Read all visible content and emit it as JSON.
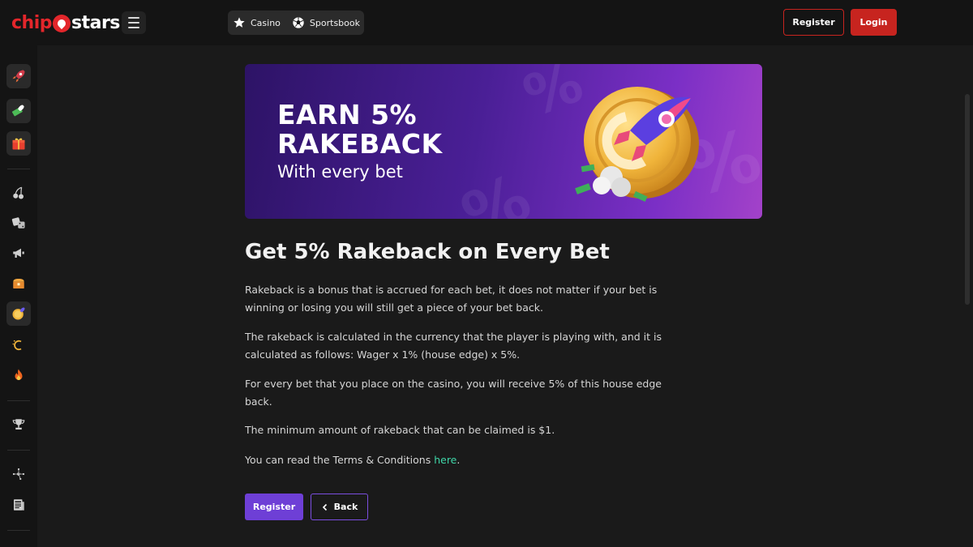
{
  "header": {
    "logo": {
      "part1": "chip",
      "part2": "stars"
    },
    "categories": [
      {
        "label": "Casino",
        "icon": "star-icon"
      },
      {
        "label": "Sportsbook",
        "icon": "soccer-ball-icon"
      }
    ],
    "register_label": "Register",
    "login_label": "Login"
  },
  "sidebar": {
    "items": [
      {
        "icon": "rocket-icon"
      },
      {
        "icon": "money-rocket-icon"
      },
      {
        "icon": "gift-icon"
      },
      {
        "icon": "cherry-icon"
      },
      {
        "icon": "dice-icon"
      },
      {
        "icon": "megaphone-icon"
      },
      {
        "icon": "treasure-chest-icon"
      },
      {
        "icon": "coin-rocket-icon"
      },
      {
        "icon": "cashback-icon"
      },
      {
        "icon": "fire-icon"
      },
      {
        "icon": "trophy-icon"
      },
      {
        "icon": "network-icon"
      },
      {
        "icon": "news-icon"
      }
    ]
  },
  "banner": {
    "headline_line1": "EARN 5%",
    "headline_line2": "RAKEBACK",
    "subline": "With every bet"
  },
  "content": {
    "title": "Get 5% Rakeback on Every Bet",
    "paragraphs": [
      "Rakeback is a bonus that is accrued for each bet, it does not matter if your bet is winning or losing you will still get a piece of your bet back.",
      "The rakeback is calculated in the currency that the player is playing with, and it is calculated as follows: Wager x 1% (house edge) x 5%.",
      "For every bet that you place on the casino, you will receive 5% of this house edge back.",
      "The minimum amount of rakeback that can be claimed is $1."
    ],
    "terms_prefix": "You can read the Terms & Conditions ",
    "terms_link": "here",
    "terms_suffix": "."
  },
  "actions": {
    "register_label": "Register",
    "back_label": "Back"
  },
  "colors": {
    "brand_red": "#c7241f",
    "accent_purple": "#6e3fd6",
    "link_green": "#3fd6a8"
  }
}
